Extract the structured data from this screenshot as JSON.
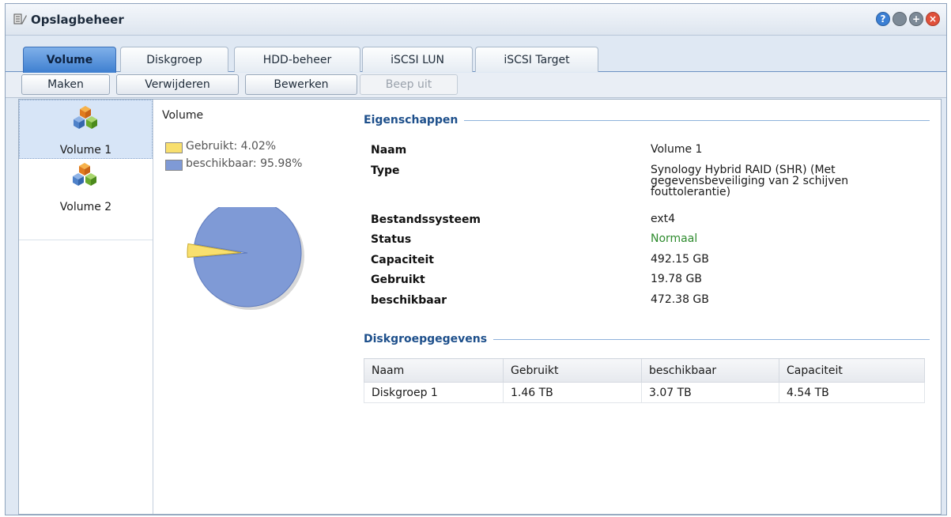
{
  "window": {
    "title": "Opslagbeheer",
    "buttons": [
      {
        "name": "help",
        "glyph": "?",
        "color": "#3b7fd4"
      },
      {
        "name": "minimize",
        "glyph": "",
        "color": "#7d8a97"
      },
      {
        "name": "maximize",
        "glyph": "+",
        "color": "#7d8a97"
      },
      {
        "name": "close",
        "glyph": "×",
        "color": "#e0503a"
      }
    ]
  },
  "tabs": [
    {
      "label": "Volume",
      "active": true
    },
    {
      "label": "Diskgroep",
      "active": false
    },
    {
      "label": "HDD-beheer",
      "active": false
    },
    {
      "label": "iSCSI LUN",
      "active": false
    },
    {
      "label": "iSCSI Target",
      "active": false
    }
  ],
  "toolbar": {
    "create_label": "Maken",
    "delete_label": "Verwijderen",
    "edit_label": "Bewerken",
    "beep_off_label": "Beep uit"
  },
  "volumes": [
    {
      "label": "Volume 1",
      "selected": true
    },
    {
      "label": "Volume 2",
      "selected": false
    }
  ],
  "chart": {
    "title": "Volume",
    "legend": [
      {
        "label": "Gebruikt: 4.02%",
        "color": "#f8df6e"
      },
      {
        "label": "beschikbaar: 95.98%",
        "color": "#7f9ad6"
      }
    ]
  },
  "chart_data": {
    "type": "pie",
    "title": "Volume",
    "slices": [
      {
        "name": "Gebruikt",
        "value": 4.02,
        "color": "#f8df6e"
      },
      {
        "name": "beschikbaar",
        "value": 95.98,
        "color": "#7f9ad6"
      }
    ]
  },
  "properties": {
    "section_title": "Eigenschappen",
    "rows": [
      {
        "key": "Naam",
        "value": "Volume 1"
      },
      {
        "key": "Type",
        "value": "Synology Hybrid RAID (SHR) (Met gegevensbeveiliging van 2 schijven fouttolerantie)"
      },
      {
        "key": "Bestandssysteem",
        "value": "ext4"
      },
      {
        "key": "Status",
        "value": "Normaal",
        "color": "#2e8b2e"
      },
      {
        "key": "Capaciteit",
        "value": "492.15 GB"
      },
      {
        "key": "Gebruikt",
        "value": "19.78 GB"
      },
      {
        "key": "beschikbaar",
        "value": "472.38 GB"
      }
    ]
  },
  "diskgroup": {
    "section_title": "Diskgroepgegevens",
    "columns": [
      "Naam",
      "Gebruikt",
      "beschikbaar",
      "Capaciteit"
    ],
    "rows": [
      [
        "Diskgroep 1",
        "1.46 TB",
        "3.07 TB",
        "4.54 TB"
      ]
    ]
  }
}
